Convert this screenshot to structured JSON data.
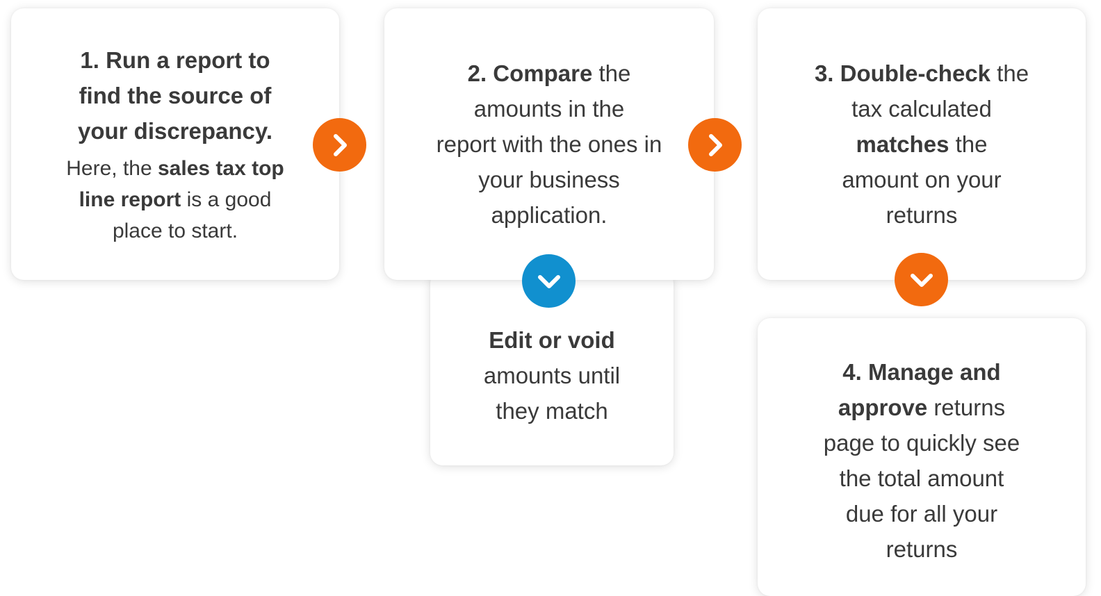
{
  "colors": {
    "orange": "#f26a0f",
    "blue": "#1190cf",
    "text": "#3a3a3a"
  },
  "cards": {
    "step1": {
      "line1_bold": "1. Run a report to",
      "line2_bold": "find the source of",
      "line3_bold": "your discrepancy.",
      "sub_a": "Here, the ",
      "sub_bold1": "sales tax top",
      "sub_bold2": "line report",
      "sub_b": " is a good",
      "sub_c": "place to start."
    },
    "step2": {
      "bold": "2. Compare",
      "rest1": " the",
      "line2": "amounts in the",
      "line3": "report with the ones in",
      "line4": "your business",
      "line5": "application."
    },
    "edit": {
      "bold": "Edit or void",
      "line2": "amounts until",
      "line3": "they match"
    },
    "step3": {
      "bold": "3. Double-check",
      "rest1": " the",
      "line2": "tax calculated",
      "bold2": "matches",
      "rest3": " the",
      "line4": "amount on your",
      "line5": "returns"
    },
    "step4": {
      "bold1": "4. Manage  and",
      "bold2": "approve",
      "rest2": "  returns",
      "line3": "page to quickly see",
      "line4": "the total amount",
      "line5": "due for all your",
      "line6": "returns"
    }
  },
  "arrows": [
    {
      "icon": "chevron-right-icon",
      "color": "#f26a0f"
    },
    {
      "icon": "chevron-right-icon",
      "color": "#f26a0f"
    },
    {
      "icon": "chevron-down-icon",
      "color": "#1190cf"
    },
    {
      "icon": "chevron-down-icon",
      "color": "#f26a0f"
    }
  ]
}
